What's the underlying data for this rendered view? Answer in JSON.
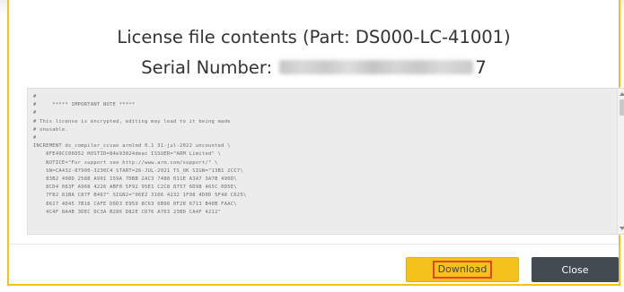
{
  "dialog": {
    "title": "License file contents (Part: DS000-LC-41001)",
    "serial_label": "Serial Number:",
    "serial_suffix": "7"
  },
  "license_text": "#\n#     ***** IMPORTANT NOTE *****\n#\n# This license is encrypted, editing may lead to it being made\n# unusable.\n#\nINCREMENT ds_compiler_ccvan armlmd 0.1 31-jul-2022 uncounted \\\n    8FE49CC06D52 HOSTID=84e93824deac ISSUER=\"ARM Limited\" \\\n    NOTICE=\"For support see http://www.arm.com/support/\" \\\n    SN=CA432-87900-3230C4 START=26-JUL-2021 TS_OK SIGN=\"13B1 2CC7\\\n    83B2 408D 2588 A901 159A 7DBB 2AC3 7488 011E A3A7 3A7B 490D\\\n    8CD4 063F A968 4226 ABF0 5F92 95E1 C2C8 8757 6D98 465C 0D5E\\\n    7F82 81BA C87F B467\" SIGN2=\"06E2 3106 4232 1F98 4D0D 5F48 C625\\\n    8617 4D45 7B16 CAFE D6D3 E959 8C63 6B90 0F28 6713 B40B FAAC\\\n    4C4F 8A4B 3DEC DC3A B286 D82E CD76 A763 23BD CA4F 4212\"",
  "buttons": {
    "download": "Download",
    "close": "Close"
  },
  "colors": {
    "accent": "#f5c21b",
    "download_highlight": "#e8432a",
    "close_button": "#434a52",
    "content_bg": "#ececec"
  }
}
